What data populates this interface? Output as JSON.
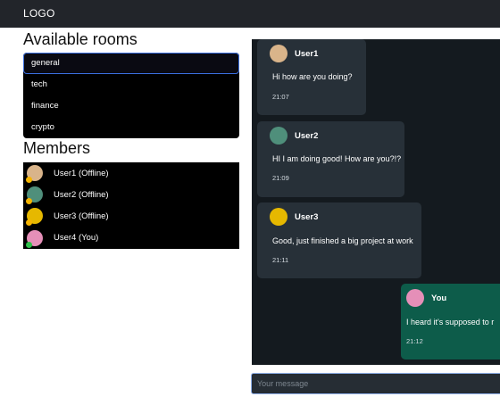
{
  "navbar": {
    "logo": "LOGO"
  },
  "rooms": {
    "title": "Available rooms",
    "items": [
      {
        "label": "general",
        "active": true
      },
      {
        "label": "tech"
      },
      {
        "label": "finance"
      },
      {
        "label": "crypto"
      }
    ]
  },
  "members": {
    "title": "Members",
    "items": [
      {
        "label": "User1 (Offline)",
        "avatar_color": "#d9b48a",
        "status_color": "#f5b400"
      },
      {
        "label": "User2 (Offline)",
        "avatar_color": "#4f8f7b",
        "status_color": "#f5b400"
      },
      {
        "label": "User3 (Offline)",
        "avatar_color": "#e6b800",
        "status_color": "#f5b400"
      },
      {
        "label": "User4 (You)",
        "avatar_color": "#e58fb8",
        "status_color": "#2fbf4a"
      }
    ]
  },
  "chat": {
    "messages": [
      {
        "user": "User1",
        "text": "Hi how are you doing?",
        "time": "21:07",
        "avatar_color": "#d9b48a"
      },
      {
        "user": "User2",
        "text": "HI I am doing good! How are you?!?",
        "time": "21:09",
        "avatar_color": "#4f8f7b"
      },
      {
        "user": "User3",
        "text": "Good, just finished a big project at work",
        "time": "21:11",
        "avatar_color": "#e6b800"
      },
      {
        "user": "You",
        "text": "I heard it's supposed to r",
        "time": "21:12",
        "avatar_color": "#e58fb8"
      }
    ]
  },
  "composer": {
    "placeholder": "Your message"
  }
}
